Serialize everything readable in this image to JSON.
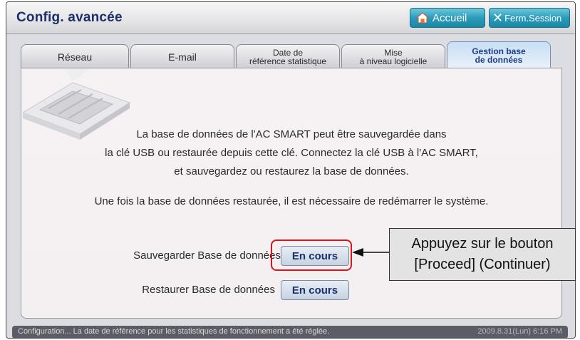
{
  "header": {
    "title": "Config. avancée",
    "home_label": "Accueil",
    "logout_label": "Ferm.Session"
  },
  "tabs": [
    {
      "label": "Réseau",
      "line1": "",
      "line2": "",
      "active": false
    },
    {
      "label": "E-mail",
      "line1": "",
      "line2": "",
      "active": false
    },
    {
      "label": "",
      "line1": "Date de",
      "line2": "référence statistique",
      "active": false
    },
    {
      "label": "",
      "line1": "Mise",
      "line2": "à niveau logicielle",
      "active": false
    },
    {
      "label": "",
      "line1": "Gestion base",
      "line2": "de données",
      "active": true
    }
  ],
  "content": {
    "line1": "La base de données de l'AC SMART peut être sauvegardée dans",
    "line2": "la clé USB ou restaurée depuis cette clé. Connectez la clé USB à l'AC SMART,",
    "line3": "et sauvegardez ou restaurez la base de données.",
    "line4": "Une fois la base de données restaurée, il est nécessaire de redémarrer le système.",
    "backup_label": "Sauvegarder Base de données",
    "restore_label": "Restaurer Base de données",
    "backup_button": "En cours",
    "restore_button": "En cours"
  },
  "callout": {
    "line1": "Appuyez sur le bouton",
    "line2": "[Proceed] (Continuer)"
  },
  "status": {
    "message": "Configuration... La date de référence pour les statistiques de fonctionnement a été réglée.",
    "datetime": "2009.8.31(Lun) 6:16 PM"
  },
  "colors": {
    "title": "#1c2f6c",
    "header_button": "#2b9cbb",
    "highlight": "#d8141c",
    "status_bar": "#5c5c66"
  },
  "icons": [
    "home-icon",
    "close-icon",
    "arrow-left-icon"
  ]
}
